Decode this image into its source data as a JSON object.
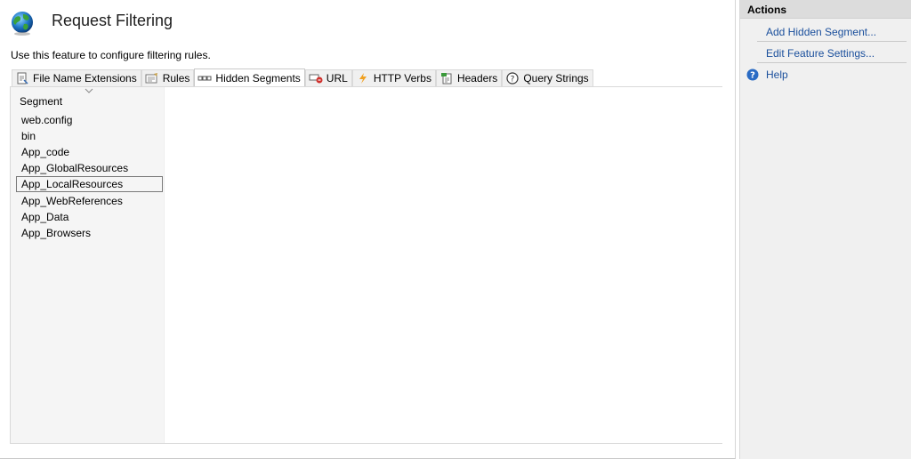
{
  "header": {
    "title": "Request Filtering",
    "description": "Use this feature to configure filtering rules."
  },
  "tabs": [
    {
      "label": "File Name Extensions",
      "icon": "file-extension-icon"
    },
    {
      "label": "Rules",
      "icon": "rules-icon"
    },
    {
      "label": "Hidden Segments",
      "icon": "hidden-segments-icon",
      "active": true
    },
    {
      "label": "URL",
      "icon": "url-icon"
    },
    {
      "label": "HTTP Verbs",
      "icon": "http-verbs-icon"
    },
    {
      "label": "Headers",
      "icon": "headers-icon"
    },
    {
      "label": "Query Strings",
      "icon": "query-strings-icon"
    }
  ],
  "segments": {
    "column_header": "Segment",
    "items": [
      "web.config",
      "bin",
      "App_code",
      "App_GlobalResources",
      "App_LocalResources",
      "App_WebReferences",
      "App_Data",
      "App_Browsers"
    ],
    "selected": "App_LocalResources"
  },
  "actions": {
    "title": "Actions",
    "add": "Add Hidden Segment...",
    "edit": "Edit Feature Settings...",
    "help": "Help"
  },
  "colors": {
    "link": "#1a4f9c",
    "actions_header": "#dcdcdc",
    "panel_bg": "#f0f0f0"
  }
}
